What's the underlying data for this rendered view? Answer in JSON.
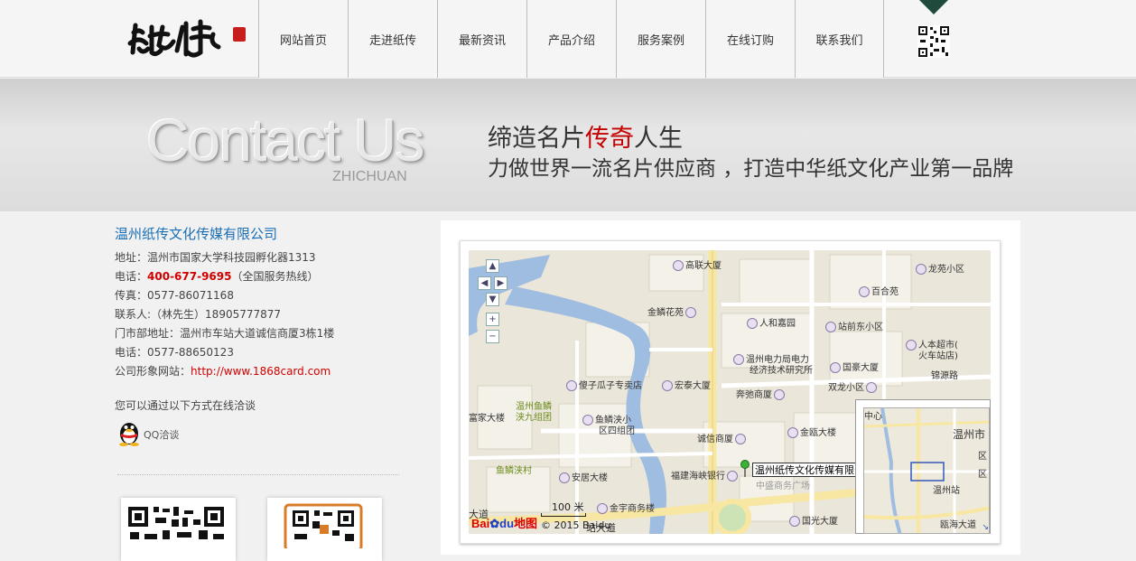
{
  "nav": {
    "logo_text": "纸传",
    "items": [
      "网站首页",
      "走进纸传",
      "最新资讯",
      "产品介绍",
      "服务案例",
      "在线订购",
      "联系我们"
    ]
  },
  "banner": {
    "big_text": "Contact Us",
    "sub_text": "ZHICHUAN",
    "slogan1_pre": "缔造名片",
    "slogan1_red": "传奇",
    "slogan1_post": "人生",
    "slogan2": "力做世界一流名片供应商 ，打造中华纸文化产业第一品牌"
  },
  "contact": {
    "company": "温州纸传文化传媒有限公司",
    "address": "地址：温州市国家大学科技园孵化器1313",
    "phone_label": "电话：",
    "phone_hot": "400-677-9695",
    "phone_note": "（全国服务热线）",
    "fax": "传真：0577-86071168",
    "contact_person": "联系人:（林先生）18905777877",
    "store_address": "门市部地址：温州市车站大道诚信商厦3栋1楼",
    "phone2": "电话：0577-88650123",
    "site_label": "公司形象网站：",
    "site_url": "http://www.1868card.com",
    "chat_title": "您可以通过以下方式在线洽谈",
    "qq_label": "QQ洽谈"
  },
  "map": {
    "labels": {
      "l1": "高联大厦",
      "l2": "龙苑小区",
      "l3": "百合苑",
      "l4": "金鳞花苑",
      "l5": "人和嘉园",
      "l6": "站前东小区",
      "l7": "温州电力局电力",
      "l7b": "经济技术研究所",
      "l8": "国豪大厦",
      "l9": "人本超市(",
      "l9b": "火车站店)",
      "l10": "锦源路",
      "l11": "傻子瓜子专卖店",
      "l12": "宏泰大厦",
      "l13": "双龙小区",
      "l14": "奔弛商厦",
      "l15": "温州鱼鳞",
      "l15b": "浃九组团",
      "l16": "富家大楼",
      "l17": "鱼鳞浃小",
      "l17b": "区四组团",
      "l18": "金瓯大楼",
      "l19": "诚信商厦",
      "l20": "鱼鳞浃村",
      "l21": "安居大楼",
      "l22": "福建海峡银行",
      "l23": "金宇商务楼",
      "l24": "国光大厦",
      "l25": "大道",
      "l26": "站大道",
      "l27": "中盛商务广场"
    },
    "callout": "温州纸传文化传媒有限公司",
    "mini_labels": {
      "m1": "中心",
      "m2": "温州市",
      "m3": "温州站",
      "m4": "瓯海大道",
      "m5": "区",
      "m6": "区"
    },
    "scale": "100 米",
    "copyright": "© 2015 Baidu",
    "brand_a": "Bai",
    "brand_b": "du",
    "brand_c": "地图"
  }
}
